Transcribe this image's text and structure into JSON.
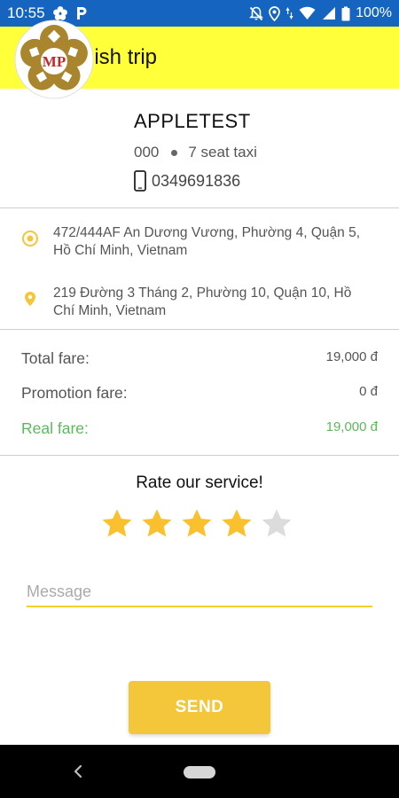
{
  "status_bar": {
    "time": "10:55",
    "battery": "100%"
  },
  "header": {
    "title": "Finish trip"
  },
  "driver": {
    "name": "APPLETEST",
    "plate": "000",
    "vehicle_type": "7 seat taxi",
    "phone": "0349691836",
    "logo_text": "MP"
  },
  "route": {
    "pickup": "472/444AF An Dương Vương, Phường 4, Quận 5, Hồ Chí Minh, Vietnam",
    "dropoff": "219 Đường 3 Tháng 2, Phường 10, Quận 10, Hồ Chí Minh, Vietnam"
  },
  "fares": {
    "total_label": "Total fare:",
    "total_value": "19,000 đ",
    "promotion_label": "Promotion fare:",
    "promotion_value": "0 đ",
    "real_label": "Real fare:",
    "real_value": "19,000 đ"
  },
  "rating": {
    "title": "Rate our service!",
    "value": 4,
    "max": 5
  },
  "message": {
    "placeholder": "Message",
    "value": ""
  },
  "send_label": "SEND",
  "colors": {
    "header": "#ffff3a",
    "status_bar": "#1565c0",
    "accent": "#f4c63a",
    "real_fare": "#5cb85c",
    "star_on": "#fbc02d",
    "star_off": "#dcdcdc"
  },
  "icons": [
    "flower-icon",
    "parking-icon",
    "notifications-off-icon",
    "location-icon",
    "data-icon",
    "wifi-icon",
    "signal-icon",
    "battery-icon",
    "phone-icon",
    "pickup-icon",
    "dropoff-icon",
    "star-icon",
    "back-icon",
    "home-icon"
  ]
}
